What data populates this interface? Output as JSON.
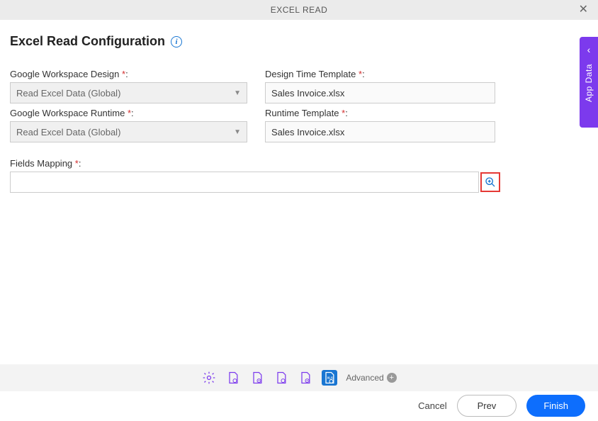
{
  "header": {
    "title": "EXCEL READ"
  },
  "page": {
    "title": "Excel Read Configuration"
  },
  "form": {
    "gw_design": {
      "label": "Google Workspace Design ",
      "value": "Read Excel Data (Global)"
    },
    "gw_runtime": {
      "label": "Google Workspace Runtime ",
      "value": "Read Excel Data (Global)"
    },
    "design_tpl": {
      "label": "Design Time Template ",
      "value": "Sales Invoice.xlsx"
    },
    "runtime_tpl": {
      "label": "Runtime Template ",
      "value": "Sales Invoice.xlsx"
    },
    "fields_mapping": {
      "label": "Fields Mapping ",
      "value": ""
    }
  },
  "toolbar": {
    "advanced": "Advanced"
  },
  "footer": {
    "cancel": "Cancel",
    "prev": "Prev",
    "finish": "Finish"
  },
  "side_tab": {
    "label": "App Data"
  },
  "colors": {
    "primary": "#0d6efd",
    "purple": "#7c3aed",
    "required": "#d32f2f"
  }
}
